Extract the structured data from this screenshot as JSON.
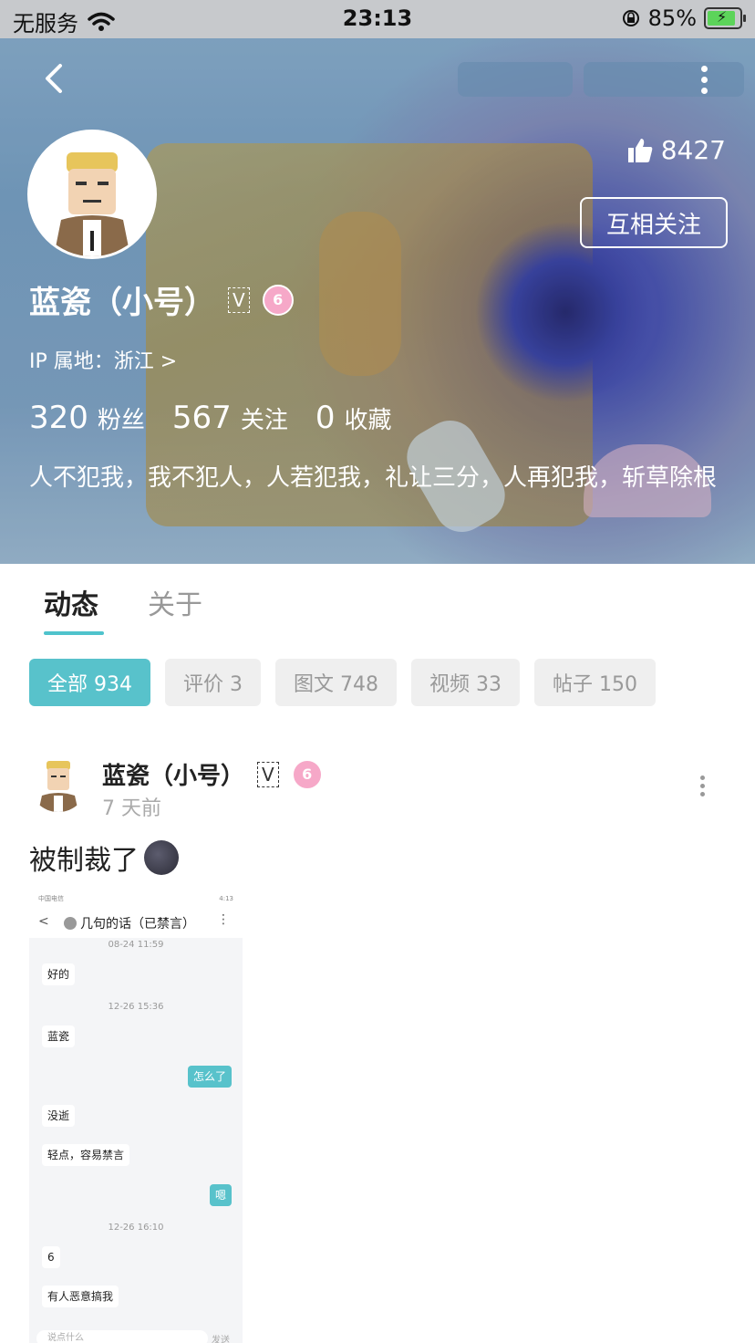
{
  "status_bar": {
    "carrier": "无服务",
    "time": "23:13",
    "battery": "85%"
  },
  "profile": {
    "likes": "8427",
    "follow_button": "互相关注",
    "name": "蓝瓷（小号）",
    "verified_badge": "V",
    "level_badge": "6",
    "ip": "IP 属地：浙江 >",
    "stats": [
      {
        "num": "320",
        "label": "粉丝"
      },
      {
        "num": "567",
        "label": "关注"
      },
      {
        "num": "0",
        "label": "收藏"
      }
    ],
    "bio": "人不犯我，我不犯人，人若犯我，礼让三分，人再犯我，斩草除根"
  },
  "tabs": [
    "动态",
    "关于"
  ],
  "filters": [
    "全部 934",
    "评价 3",
    "图文 748",
    "视频 33",
    "帖子 150"
  ],
  "post": {
    "author": "蓝瓷（小号）",
    "verified_badge": "V",
    "level_badge": "6",
    "time": "7 天前",
    "text": "被制裁了",
    "screenshot": {
      "status_left": "中国电信",
      "status_right": "4:13",
      "title": "几句的话（已禁言）",
      "timestamps": [
        "08-24 11:59",
        "12-26 15:36",
        "12-26 16:10"
      ],
      "messages": [
        "好的",
        "蓝瓷",
        "怎么了",
        "没逝",
        "轻点，容易禁言",
        "嗯",
        "6",
        "有人恶意搞我"
      ],
      "input_placeholder": "说点什么",
      "send": "发送"
    }
  },
  "colors": {
    "accent": "#58c2cb"
  }
}
